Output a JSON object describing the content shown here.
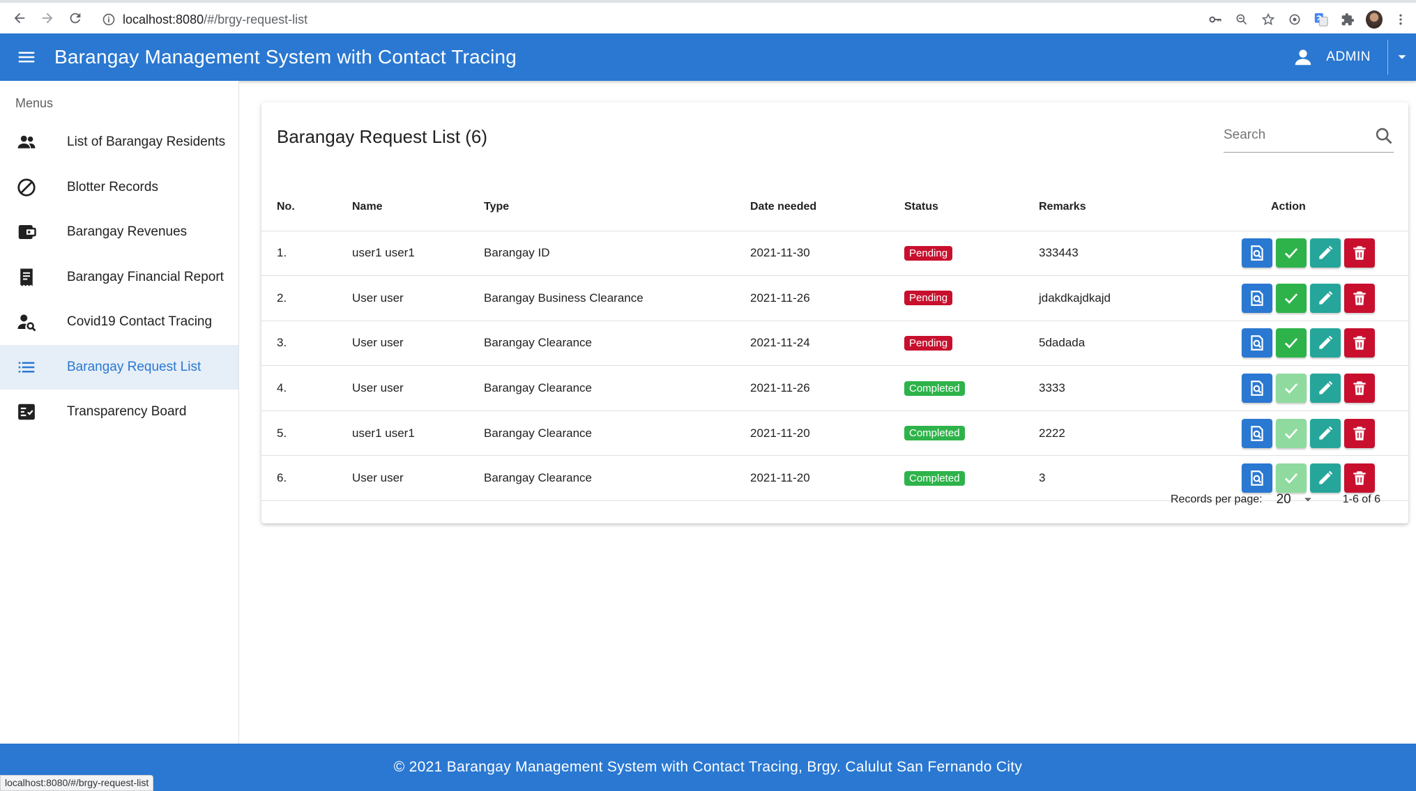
{
  "browser": {
    "url_host": "localhost:8080",
    "url_path": "/#/brgy-request-list"
  },
  "app": {
    "title": "Barangay Management System with Contact Tracing",
    "user_label": "ADMIN"
  },
  "sidebar": {
    "header": "Menus",
    "items": [
      {
        "label": "List of Barangay Residents",
        "icon": "people-icon"
      },
      {
        "label": "Blotter Records",
        "icon": "block-icon"
      },
      {
        "label": "Barangay Revenues",
        "icon": "wallet-icon"
      },
      {
        "label": "Barangay Financial Report",
        "icon": "receipt-icon"
      },
      {
        "label": "Covid19 Contact Tracing",
        "icon": "person-search-icon"
      },
      {
        "label": "Barangay Request List",
        "icon": "list-icon",
        "active": true
      },
      {
        "label": "Transparency Board",
        "icon": "checklist-icon"
      }
    ]
  },
  "card": {
    "title": "Barangay Request List (6)",
    "search_placeholder": "Search"
  },
  "table": {
    "headers": {
      "no": "No.",
      "name": "Name",
      "type": "Type",
      "date": "Date needed",
      "status": "Status",
      "remarks": "Remarks",
      "action": "Action"
    },
    "rows": [
      {
        "no": "1.",
        "name": "user1 user1",
        "type": "Barangay ID",
        "date": "2021-11-30",
        "status": "Pending",
        "remarks": "333443"
      },
      {
        "no": "2.",
        "name": "User user",
        "type": "Barangay Business Clearance",
        "date": "2021-11-26",
        "status": "Pending",
        "remarks": "jdakdkajdkajd"
      },
      {
        "no": "3.",
        "name": "User user",
        "type": "Barangay Clearance",
        "date": "2021-11-24",
        "status": "Pending",
        "remarks": "5dadada"
      },
      {
        "no": "4.",
        "name": "User user",
        "type": "Barangay Clearance",
        "date": "2021-11-26",
        "status": "Completed",
        "remarks": "3333"
      },
      {
        "no": "5.",
        "name": "user1 user1",
        "type": "Barangay Clearance",
        "date": "2021-11-20",
        "status": "Completed",
        "remarks": "2222"
      },
      {
        "no": "6.",
        "name": "User user",
        "type": "Barangay Clearance",
        "date": "2021-11-20",
        "status": "Completed",
        "remarks": "3"
      }
    ]
  },
  "pagination": {
    "records_per_page_label": "Records per page:",
    "records_per_page": "20",
    "range": "1-6 of 6"
  },
  "footer": {
    "text": "© 2021 Barangay Management System with Contact Tracing, Brgy. Calulut San Fernando City"
  },
  "status_tip": "localhost:8080/#/brgy-request-list",
  "colors": {
    "primary": "#2a78d1",
    "pending": "#c8102e",
    "completed": "#2eb34a",
    "edit": "#26a69a"
  }
}
